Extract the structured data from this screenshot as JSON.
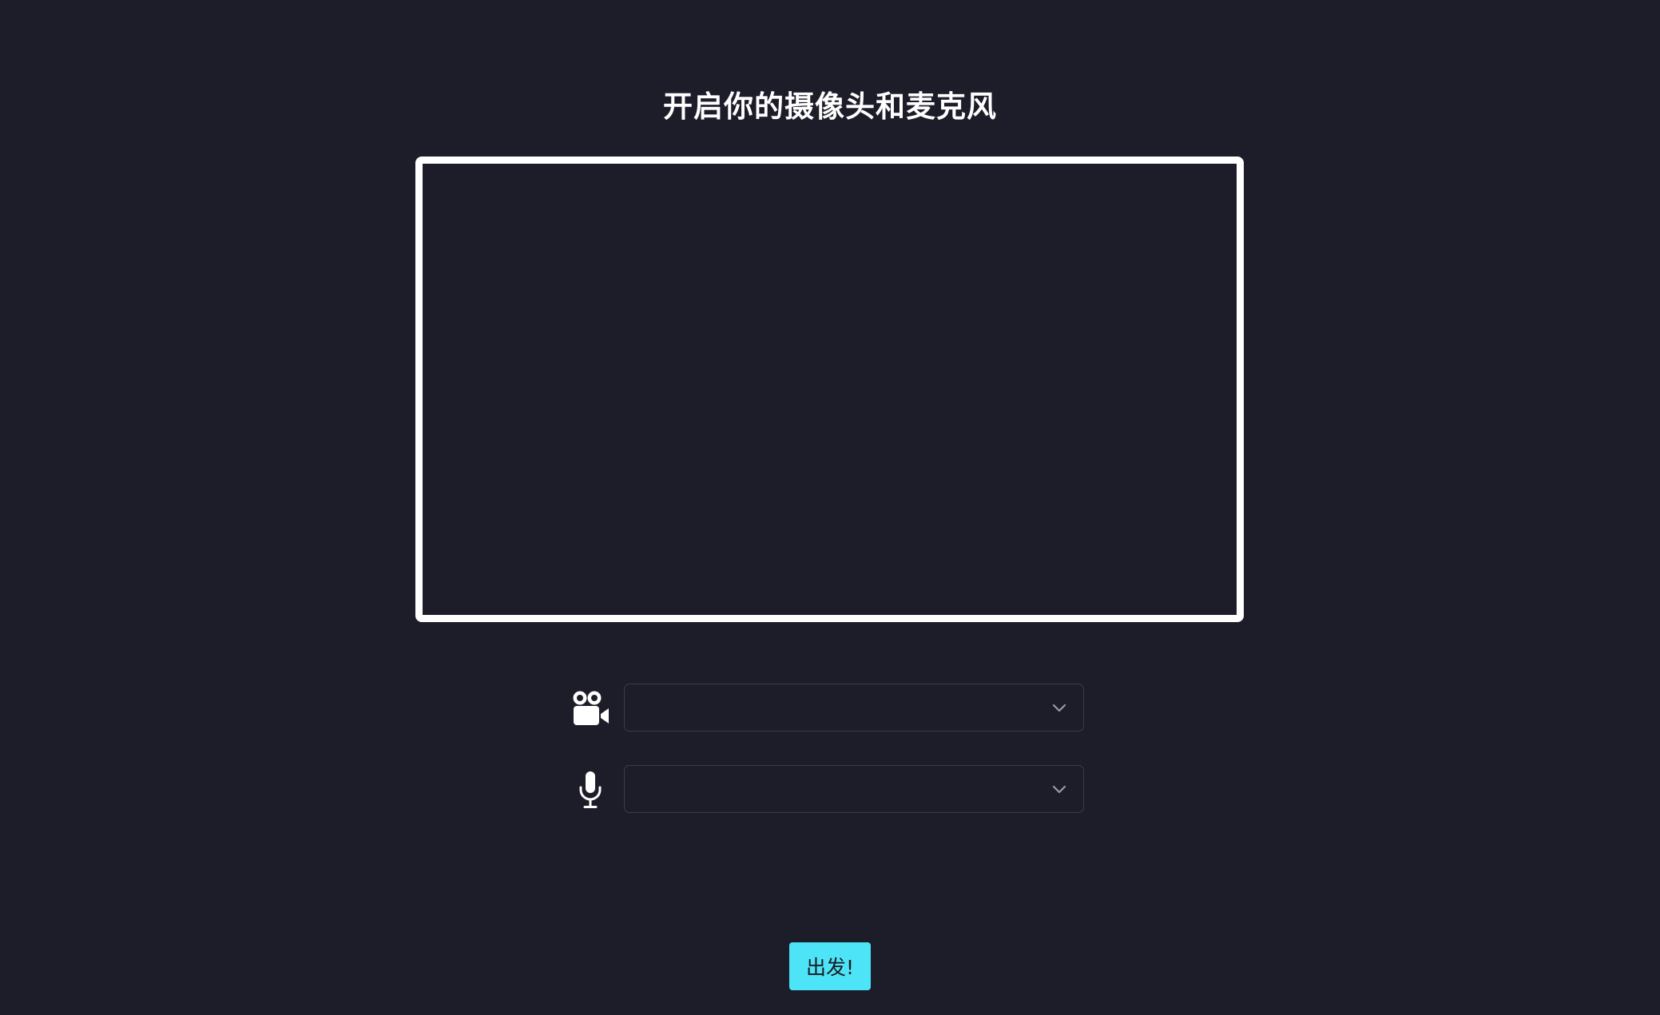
{
  "page": {
    "title": "开启你的摄像头和麦克风"
  },
  "camera_select": {
    "icon": "video-camera-icon",
    "value": ""
  },
  "mic_select": {
    "icon": "microphone-icon",
    "value": ""
  },
  "actions": {
    "go_label": "出发!"
  },
  "colors": {
    "background": "#1d1c29",
    "preview_border": "#ffffff",
    "accent": "#4ee4f7"
  }
}
